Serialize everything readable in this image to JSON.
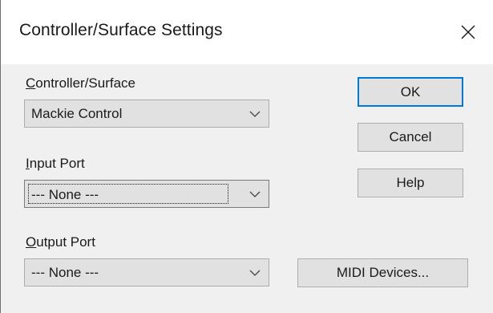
{
  "window": {
    "title": "Controller/Surface Settings",
    "close_glyph": "✕"
  },
  "fields": {
    "controller_surface": {
      "label_underlined": "C",
      "label_rest": "ontroller/Surface",
      "value": "Mackie Control"
    },
    "input_port": {
      "label_underlined": "I",
      "label_rest": "nput Port",
      "value": "--- None ---"
    },
    "output_port": {
      "label_underlined": "O",
      "label_rest": "utput Port",
      "value": "--- None ---"
    }
  },
  "buttons": {
    "ok": "OK",
    "cancel": "Cancel",
    "help": "Help",
    "midi_devices": "MIDI Devices..."
  },
  "icons": {
    "close": "close-icon",
    "dropdown": "chevron-down-icon"
  },
  "colors": {
    "default_button_border": "#0078d7",
    "dialog_background": "#f0f0f0",
    "titlebar_background": "#ffffff"
  }
}
